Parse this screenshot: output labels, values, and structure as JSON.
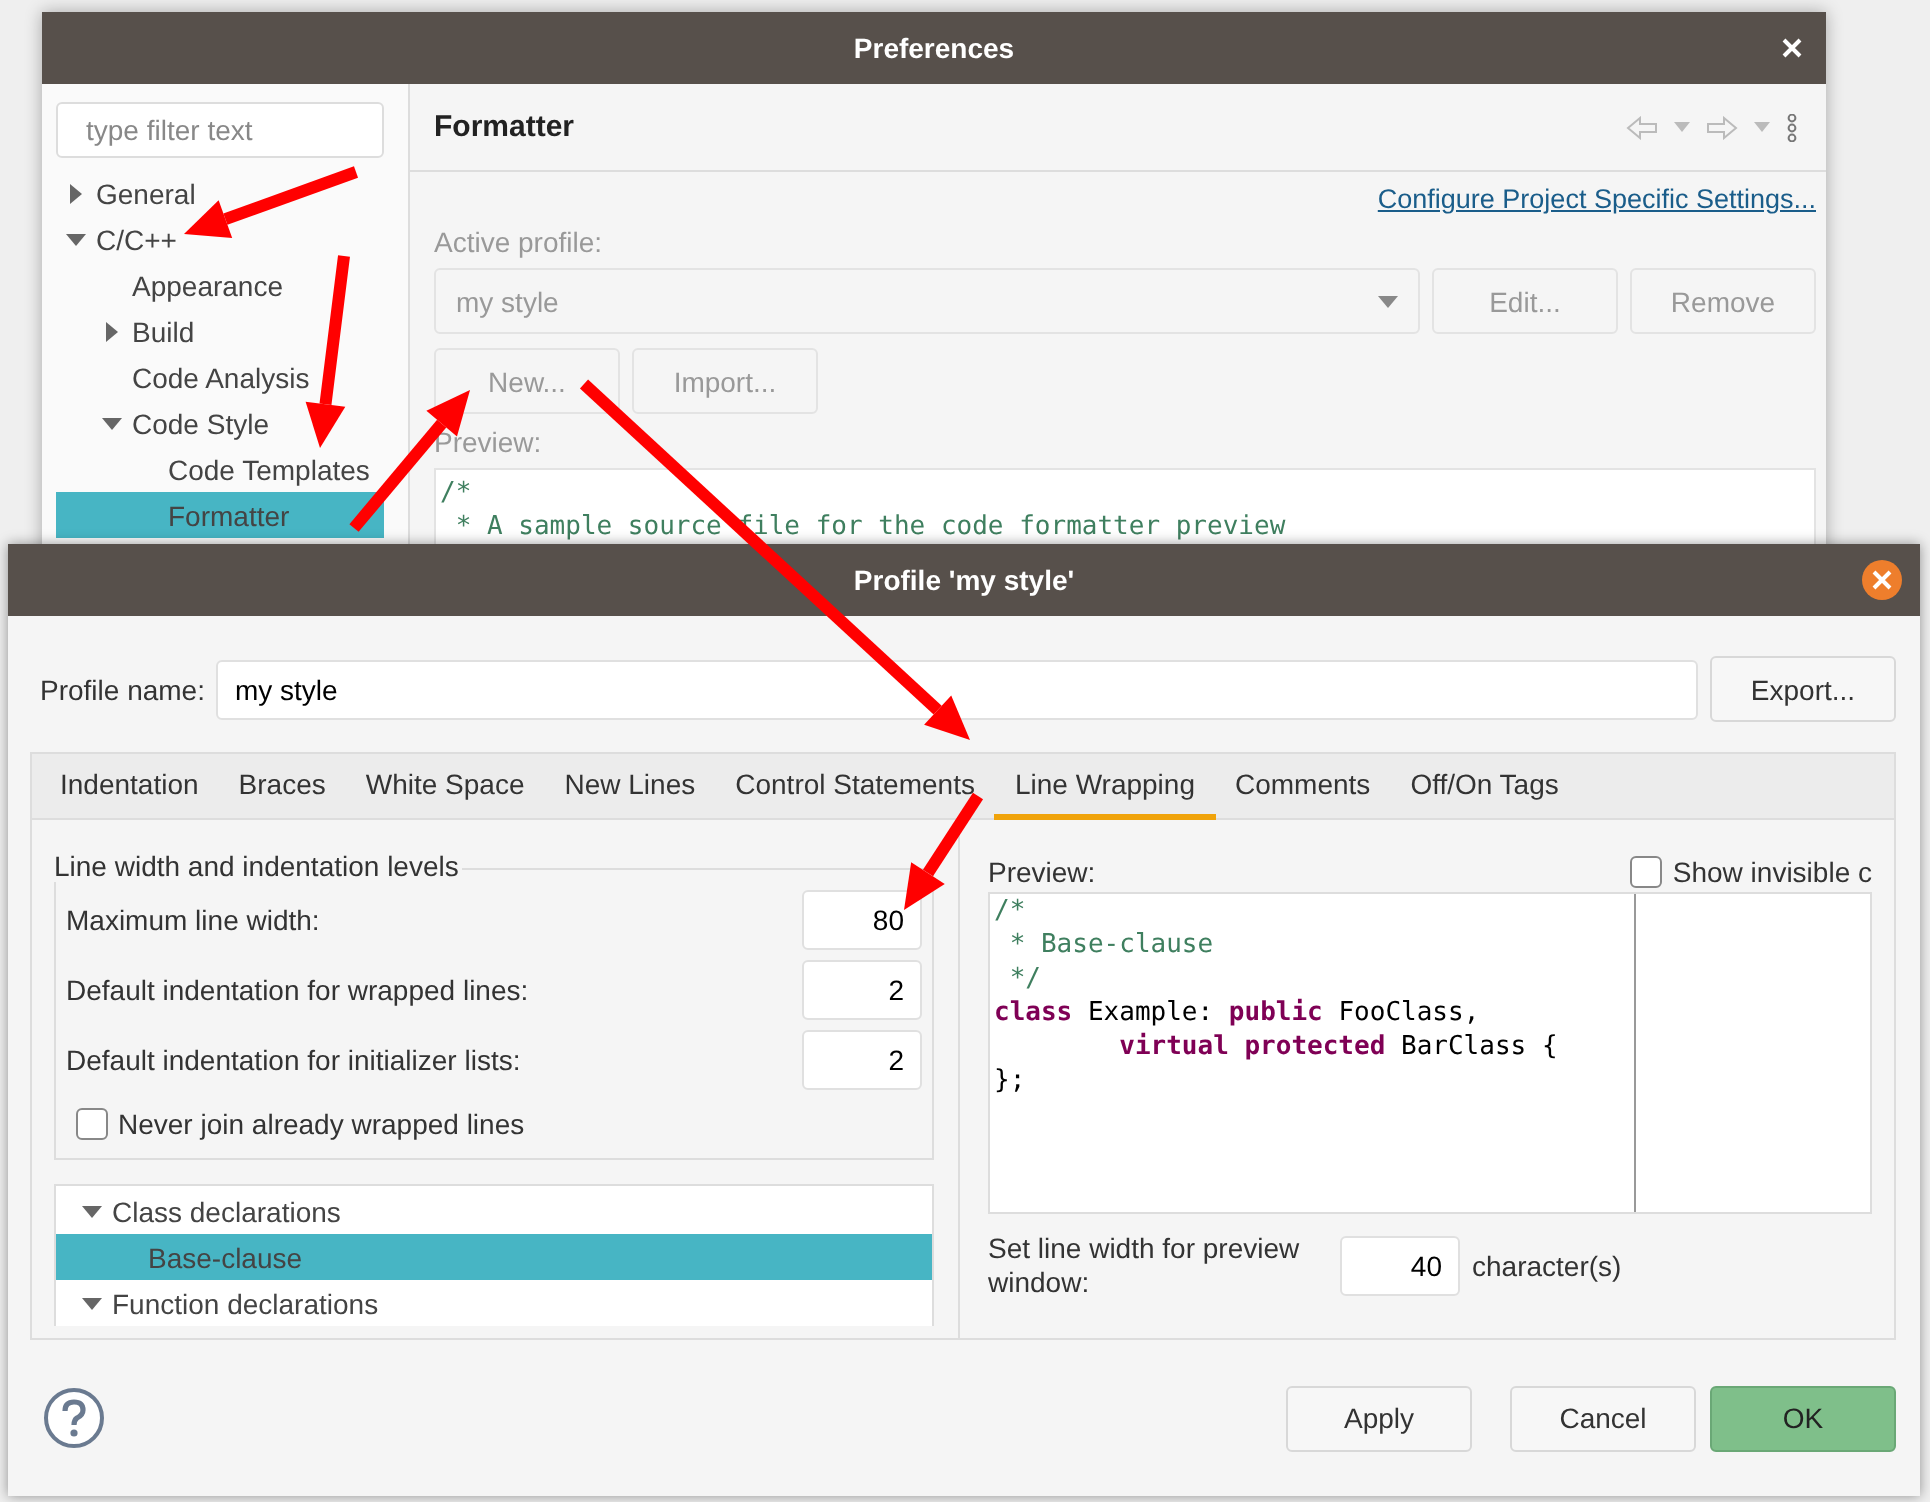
{
  "preferences_window": {
    "title": "Preferences",
    "filter": {
      "placeholder": "type filter text"
    },
    "tree": [
      {
        "label": "General",
        "expanded": false,
        "selected": false
      },
      {
        "label": "C/C++",
        "expanded": true,
        "selected": false,
        "children": [
          {
            "label": "Appearance",
            "selected": false
          },
          {
            "label": "Build",
            "expanded": false,
            "selected": false
          },
          {
            "label": "Code Analysis",
            "selected": false
          },
          {
            "label": "Code Style",
            "expanded": true,
            "selected": false,
            "children": [
              {
                "label": "Code Templates",
                "selected": false
              },
              {
                "label": "Formatter",
                "selected": true
              }
            ]
          }
        ]
      }
    ],
    "page_title": "Formatter",
    "link": "Configure Project Specific Settings...",
    "active_profile": {
      "label": "Active profile:",
      "value": "my style"
    },
    "profile_buttons": [
      "Edit...",
      "Remove"
    ],
    "action_buttons": [
      "New...",
      "Import..."
    ],
    "preview_label": "Preview:",
    "preview_lines": [
      "/*",
      " * A sample source file for the code formatter preview"
    ]
  },
  "profile_dialog": {
    "title": "Profile 'my style'",
    "profile_name": {
      "label": "Profile name:",
      "value": "my style"
    },
    "export_button": "Export...",
    "tabs": [
      {
        "label": "Indentation",
        "selected": false
      },
      {
        "label": "Braces",
        "selected": false
      },
      {
        "label": "White Space",
        "selected": false
      },
      {
        "label": "New Lines",
        "selected": false
      },
      {
        "label": "Control Statements",
        "selected": false
      },
      {
        "label": "Line Wrapping",
        "selected": true
      },
      {
        "label": "Comments",
        "selected": false
      },
      {
        "label": "Off/On Tags",
        "selected": false
      }
    ],
    "group_title": "Line width and indentation levels",
    "fields": [
      {
        "label": "Maximum line width:",
        "value": "80"
      },
      {
        "label": "Default indentation for wrapped lines:",
        "value": "2"
      },
      {
        "label": "Default indentation for initializer lists:",
        "value": "2"
      }
    ],
    "never_join": {
      "label": "Never join already wrapped lines",
      "checked": false
    },
    "element_tree": [
      {
        "label": "Class declarations",
        "expanded": true,
        "selected": false,
        "children": [
          {
            "label": "Base-clause",
            "selected": true
          }
        ]
      },
      {
        "label": "Function declarations",
        "expanded": true,
        "selected": false
      }
    ],
    "preview_label": "Preview:",
    "show_invisible": {
      "label": "Show invisible c",
      "checked": false
    },
    "preview_code": [
      [
        {
          "text": "/*",
          "kind": "comment"
        }
      ],
      [
        {
          "text": " * Base-clause",
          "kind": "comment"
        }
      ],
      [
        {
          "text": " */",
          "kind": "comment"
        }
      ],
      [
        {
          "text": "class",
          "kind": "keyword"
        },
        {
          "text": " Example: ",
          "kind": "plain"
        },
        {
          "text": "public",
          "kind": "keyword"
        },
        {
          "text": " FooClass,",
          "kind": "plain"
        }
      ],
      [
        {
          "text": "        virtual protected",
          "kind": "keyword"
        },
        {
          "text": " BarClass {",
          "kind": "plain"
        }
      ],
      [
        {
          "text": "};",
          "kind": "plain"
        }
      ]
    ],
    "preview_width": {
      "label": "Set line width for preview window:",
      "value": "40",
      "unit": "character(s)"
    },
    "buttons": [
      {
        "label": "Apply",
        "kind": "normal"
      },
      {
        "label": "Cancel",
        "kind": "normal"
      },
      {
        "label": "OK",
        "kind": "default"
      }
    ]
  }
}
